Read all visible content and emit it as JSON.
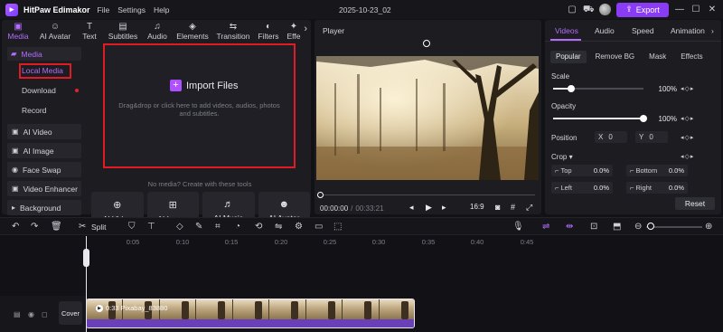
{
  "titlebar": {
    "app_name": "HitPaw Edimakor",
    "menu": [
      "File",
      "Settings",
      "Help"
    ],
    "project_title": "2025-10-23_02",
    "export_label": "Export"
  },
  "tool_tabs": [
    {
      "label": "Media",
      "icon": "media-icon",
      "glyph": "▣"
    },
    {
      "label": "AI Avatar",
      "icon": "ai-avatar-icon",
      "glyph": "☺"
    },
    {
      "label": "Text",
      "icon": "text-icon",
      "glyph": "T"
    },
    {
      "label": "Subtitles",
      "icon": "subtitles-icon",
      "glyph": "▤"
    },
    {
      "label": "Audio",
      "icon": "audio-icon",
      "glyph": "♫"
    },
    {
      "label": "Elements",
      "icon": "elements-icon",
      "glyph": "◈"
    },
    {
      "label": "Transition",
      "icon": "transition-icon",
      "glyph": "⇆"
    },
    {
      "label": "Filters",
      "icon": "filters-icon",
      "glyph": "◐"
    },
    {
      "label": "Effe",
      "icon": "effects-icon",
      "glyph": "✦"
    }
  ],
  "sidebar": {
    "head": "Media",
    "sub_items": [
      "Local Media",
      "Download",
      "Record"
    ],
    "items": [
      "AI Video",
      "AI Image",
      "Face Swap",
      "Video Enhancer",
      "Background"
    ]
  },
  "import": {
    "button_label": "Import Files",
    "description": "Drag&drop or click here to add videos, audios, photos and subtitles."
  },
  "no_media_text": "No media? Create with these tools",
  "tool_cards": [
    "AI Video",
    "AI Image",
    "AI Music",
    "AI Avatar"
  ],
  "player": {
    "title": "Player",
    "time_current": "00:00:00",
    "time_separator": "/",
    "time_total": "00:33:21",
    "ratio": "16:9"
  },
  "props": {
    "tabs": [
      "Videos",
      "Audio",
      "Speed",
      "Animation"
    ],
    "subtabs": [
      "Popular",
      "Remove BG",
      "Mask",
      "Effects"
    ],
    "scale_label": "Scale",
    "scale_value": "100%",
    "scale_level": 0.2,
    "opacity_label": "Opacity",
    "opacity_value": "100%",
    "opacity_level": 1.0,
    "position_label": "Position",
    "pos_x_label": "X",
    "pos_x": "0",
    "pos_y_label": "Y",
    "pos_y": "0",
    "crop_label": "Crop",
    "crop_top_label": "Top",
    "crop_top": "0.0%",
    "crop_bottom_label": "Bottom",
    "crop_bottom": "0.0%",
    "crop_left_label": "Left",
    "crop_left": "0.0%",
    "crop_right_label": "Right",
    "crop_right": "0.0%",
    "reset_label": "Reset"
  },
  "toolbar": {
    "split_label": "Split"
  },
  "timeline": {
    "ticks": [
      "0:05",
      "0:10",
      "0:15",
      "0:20",
      "0:25",
      "0:30",
      "0:35",
      "0:40",
      "0:45"
    ],
    "cover_label": "Cover",
    "clip_label": "0:33  Pixabay_83880"
  },
  "colors": {
    "accent": "#8a3cf5",
    "accent_text": "#b46dff",
    "highlight_border": "#e01b24"
  }
}
